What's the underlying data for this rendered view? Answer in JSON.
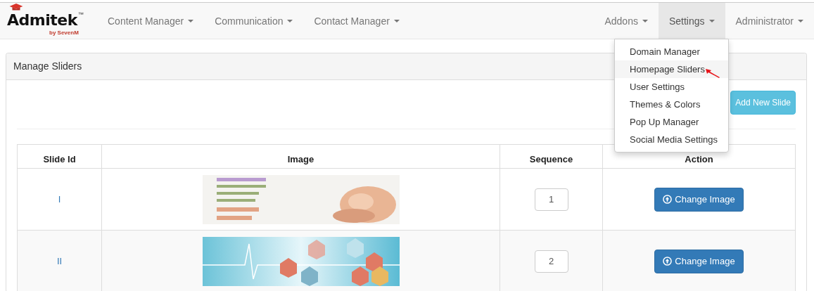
{
  "logo": {
    "name": "Admitek",
    "trademark": "™",
    "tagline": "by SevenM"
  },
  "nav": {
    "left": [
      {
        "label": "Content Manager",
        "selected": false
      },
      {
        "label": "Communication",
        "selected": false
      },
      {
        "label": "Contact Manager",
        "selected": false
      }
    ],
    "right": [
      {
        "label": "Addons",
        "selected": false
      },
      {
        "label": "Settings",
        "selected": true
      },
      {
        "label": "Administrator",
        "selected": false
      }
    ]
  },
  "dropdown": {
    "items": [
      {
        "label": "Domain Manager",
        "selected": false
      },
      {
        "label": "Homepage Sliders",
        "selected": true
      },
      {
        "label": "User Settings",
        "selected": false
      },
      {
        "label": "Themes & Colors",
        "selected": false
      },
      {
        "label": "Pop Up Manager",
        "selected": false
      },
      {
        "label": "Social Media Settings",
        "selected": false
      }
    ]
  },
  "panel": {
    "title": "Manage Sliders",
    "add_button": "Add New Slide"
  },
  "table": {
    "columns": [
      "Slide Id",
      "Image",
      "Sequence",
      "Action"
    ],
    "rows": [
      {
        "id": "I",
        "sequence": "1",
        "action": "Change Image"
      },
      {
        "id": "II",
        "sequence": "2",
        "action": "Change Image"
      }
    ]
  }
}
